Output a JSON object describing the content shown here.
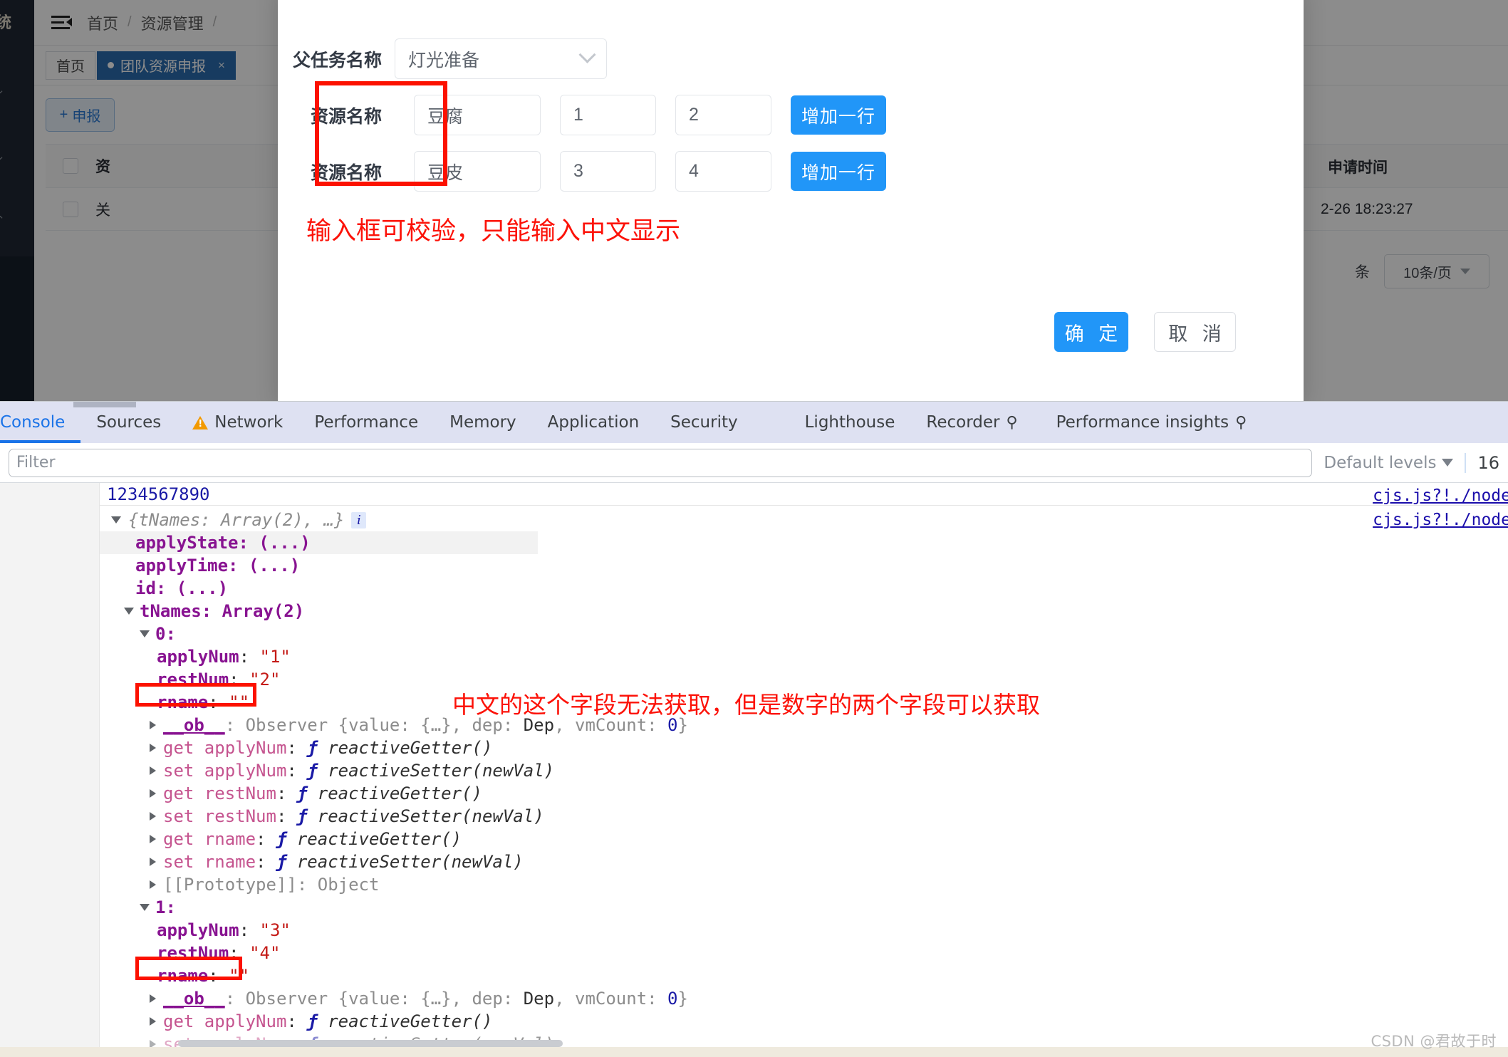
{
  "app": {
    "sidebar": {
      "logo_text": "统",
      "chevrons": [
        "⌄",
        "⌄",
        "⌃"
      ]
    },
    "header": {
      "collapse_icon": "collapse-menu-icon",
      "breadcrumb": [
        "首页",
        "/",
        "资源管理",
        "/"
      ]
    },
    "tabs": [
      {
        "label": "首页",
        "active": false
      },
      {
        "label": "团队资源申报",
        "active": true,
        "close": "×"
      }
    ],
    "toolbar": {
      "declare_label": "申报",
      "declare_plus": "+"
    },
    "table": {
      "headers": [
        "资",
        "申请时间"
      ],
      "rows": [
        {
          "col_a": "关",
          "apply_time": "2-26 18:23:27"
        }
      ]
    },
    "pager": {
      "unit": "条",
      "page_size": "10条/页"
    }
  },
  "modal": {
    "parent_task": {
      "label": "父任务名称",
      "value": "灯光准备"
    },
    "rows": [
      {
        "label": "资源名称",
        "name": "豆腐",
        "apply_num": "1",
        "rest_num": "2",
        "add_label": "增加一行"
      },
      {
        "label": "资源名称",
        "name": "豆皮",
        "apply_num": "3",
        "rest_num": "4",
        "add_label": "增加一行"
      }
    ],
    "note": "输入框可校验，只能输入中文显示",
    "confirm_label": "确 定",
    "cancel_label": "取 消"
  },
  "devtools": {
    "tabs": [
      {
        "label": "Console",
        "active": true,
        "icon": ""
      },
      {
        "label": "Sources",
        "active": false,
        "icon": ""
      },
      {
        "label": "Network",
        "active": false,
        "icon": "warning-triangle-icon"
      },
      {
        "label": "Performance",
        "active": false,
        "icon": ""
      },
      {
        "label": "Memory",
        "active": false,
        "icon": ""
      },
      {
        "label": "Application",
        "active": false,
        "icon": ""
      },
      {
        "label": "Security",
        "active": false,
        "icon": ""
      },
      {
        "label": "Lighthouse",
        "active": false,
        "icon": ""
      },
      {
        "label": "Recorder",
        "active": false,
        "icon": "flask-icon"
      },
      {
        "label": "Performance insights",
        "active": false,
        "icon": "flask-icon"
      }
    ],
    "filter": {
      "placeholder": "Filter",
      "value": ""
    },
    "levels": {
      "label": "Default levels",
      "count": "16"
    },
    "source_links": [
      "cjs.js?!./node",
      "cjs.js?!./node"
    ],
    "console": {
      "first_log": "1234567890",
      "object_header": "{tNames: Array(2), …}",
      "info_icon": "i",
      "lines": [
        "applyState: (...)",
        "applyTime: (...)",
        "id: (...)",
        "tNames: Array(2)"
      ],
      "index0": "0:",
      "index1": "1:",
      "item0": {
        "applyNum": "\"1\"",
        "restNum": "\"2\"",
        "rname": "\"\""
      },
      "item1": {
        "applyNum": "\"3\"",
        "restNum": "\"4\"",
        "rname": "\"\""
      },
      "observer": "__ob__: Observer {value: {…}, dep: Dep, vmCount: 0}",
      "accessors": [
        "get applyNum: ƒ reactiveGetter()",
        "set applyNum: ƒ reactiveSetter(newVal)",
        "get restNum: ƒ reactiveGetter()",
        "set restNum: ƒ reactiveSetter(newVal)",
        "get rname: ƒ reactiveGetter()",
        "set rname: ƒ reactiveSetter(newVal)"
      ],
      "prototype": "[[Prototype]]: Object",
      "tail_accessor": "get applyNum: ƒ reactiveGetter()",
      "note": "中文的这个字段无法获取，但是数字的两个字段可以获取"
    }
  },
  "watermark": "CSDN @君故于时",
  "colors": {
    "accent_blue": "#2196f8",
    "tab_blue": "#2b6cb0",
    "devtools_active": "#1a73e8",
    "annotation_red": "#fc1208",
    "sidebar_dark": "#1f2733"
  }
}
